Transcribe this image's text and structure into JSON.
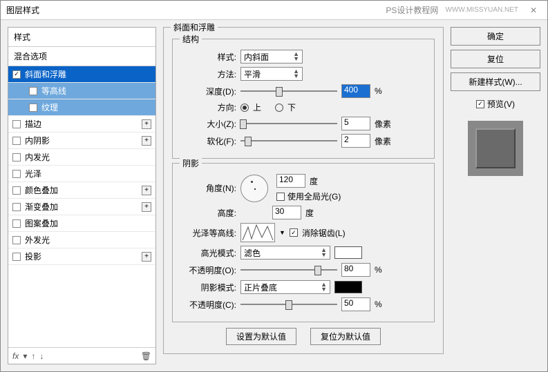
{
  "title": "图层样式",
  "watermark": "PS设计教程网",
  "left": {
    "styles_label": "样式",
    "blend_label": "混合选项",
    "items": [
      {
        "label": "斜面和浮雕",
        "checked": true,
        "selected": true,
        "plus": false
      },
      {
        "label": "等高线",
        "checked": false,
        "sub": true,
        "sub_sel": true
      },
      {
        "label": "纹理",
        "checked": false,
        "sub": true,
        "sub_sel": true
      },
      {
        "label": "描边",
        "checked": false,
        "plus": true
      },
      {
        "label": "内阴影",
        "checked": false,
        "plus": true
      },
      {
        "label": "内发光",
        "checked": false
      },
      {
        "label": "光泽",
        "checked": false
      },
      {
        "label": "颜色叠加",
        "checked": false,
        "plus": true
      },
      {
        "label": "渐变叠加",
        "checked": false,
        "plus": true
      },
      {
        "label": "图案叠加",
        "checked": false
      },
      {
        "label": "外发光",
        "checked": false
      },
      {
        "label": "投影",
        "checked": false,
        "plus": true
      }
    ],
    "fx": "fx"
  },
  "center": {
    "panel_title": "斜面和浮雕",
    "structure": "结构",
    "style_label": "样式:",
    "style_value": "内斜面",
    "method_label": "方法:",
    "method_value": "平滑",
    "depth_label": "深度(D):",
    "depth_value": "400",
    "percent": "%",
    "direction_label": "方向:",
    "dir_up": "上",
    "dir_down": "下",
    "size_label": "大小(Z):",
    "size_value": "5",
    "px": "像素",
    "soften_label": "软化(F):",
    "soften_value": "2",
    "shading": "阴影",
    "angle_label": "角度(N):",
    "angle_value": "120",
    "deg": "度",
    "global_light": "使用全局光(G)",
    "altitude_label": "高度:",
    "altitude_value": "30",
    "gloss_contour_label": "光泽等高线:",
    "antialias": "消除锯齿(L)",
    "highlight_mode_label": "高光模式:",
    "highlight_mode_value": "滤色",
    "hl_opacity_label": "不透明度(O):",
    "hl_opacity_value": "80",
    "shadow_mode_label": "阴影模式:",
    "shadow_mode_value": "正片叠底",
    "sh_opacity_label": "不透明度(C):",
    "sh_opacity_value": "50",
    "default_btn": "设置为默认值",
    "reset_btn": "复位为默认值"
  },
  "right": {
    "ok": "确定",
    "cancel": "复位",
    "new_style": "新建样式(W)...",
    "preview": "预览(V)"
  }
}
